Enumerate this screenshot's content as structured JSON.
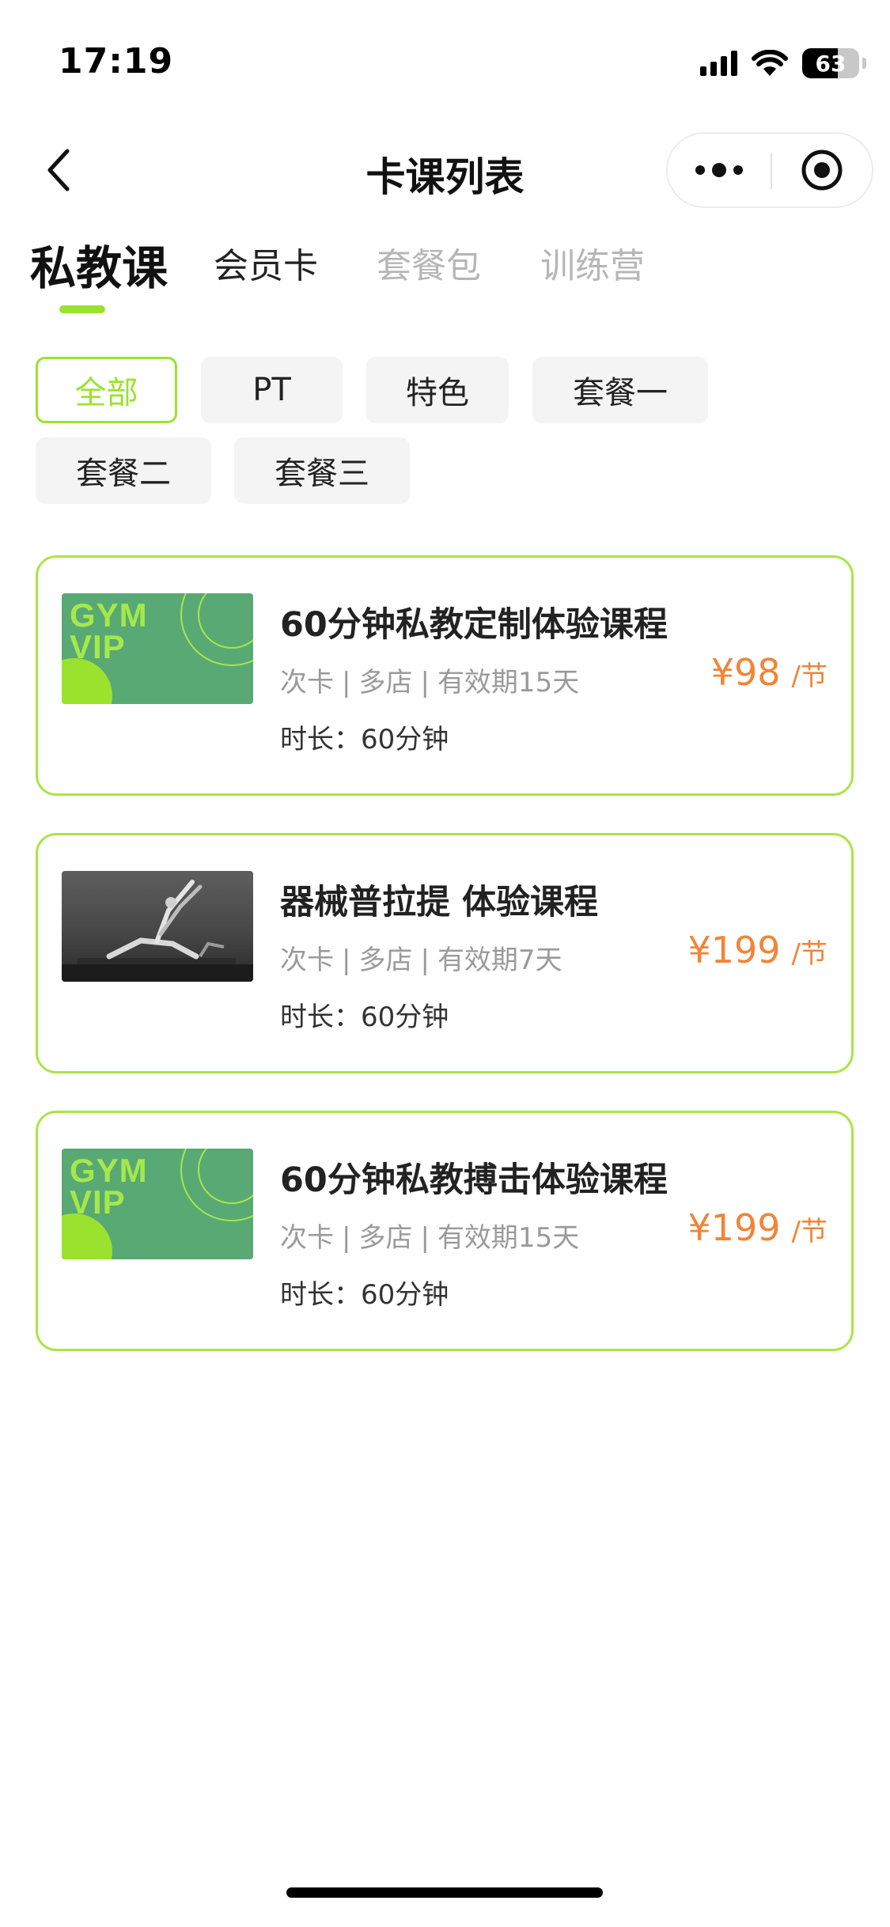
{
  "status_bar": {
    "time": "17:19",
    "battery": "63",
    "battery_level": 0.63
  },
  "nav": {
    "title": "卡课列表"
  },
  "tabs": [
    {
      "label": "私教课",
      "active": true
    },
    {
      "label": "会员卡",
      "active": false
    },
    {
      "label": "套餐包",
      "active": false
    },
    {
      "label": "训练营",
      "active": false
    }
  ],
  "filters": [
    {
      "label": "全部",
      "active": true
    },
    {
      "label": "PT",
      "active": false
    },
    {
      "label": "特色",
      "active": false
    },
    {
      "label": "套餐一",
      "active": false
    },
    {
      "label": "套餐二",
      "active": false
    },
    {
      "label": "套餐三",
      "active": false
    }
  ],
  "courses": [
    {
      "thumb_type": "gym-vip",
      "thumb_text_line1": "GYM",
      "thumb_text_line2": "VIP",
      "title": "60分钟私教定制体验课程",
      "card_type": "次卡",
      "store": "多店",
      "validity": "有效期15天",
      "duration": "时长：60分钟",
      "price": "¥98",
      "unit": "/节"
    },
    {
      "thumb_type": "photo",
      "title": "器械普拉提 体验课程",
      "card_type": "次卡",
      "store": "多店",
      "validity": "有效期7天",
      "duration": "时长：60分钟",
      "price": "¥199",
      "unit": "/节"
    },
    {
      "thumb_type": "gym-vip",
      "thumb_text_line1": "GYM",
      "thumb_text_line2": "VIP",
      "title": "60分钟私教搏击体验课程",
      "card_type": "次卡",
      "store": "多店",
      "validity": "有效期15天",
      "duration": "时长：60分钟",
      "price": "¥199",
      "unit": "/节"
    }
  ],
  "colors": {
    "accent": "#9be22f",
    "card_border": "#a9e545",
    "price": "#f08537",
    "thumb_green": "#59a975"
  },
  "icons": [
    "signal-icon",
    "wifi-icon",
    "battery-icon",
    "back-chevron-icon",
    "more-dots-icon",
    "close-target-icon"
  ]
}
